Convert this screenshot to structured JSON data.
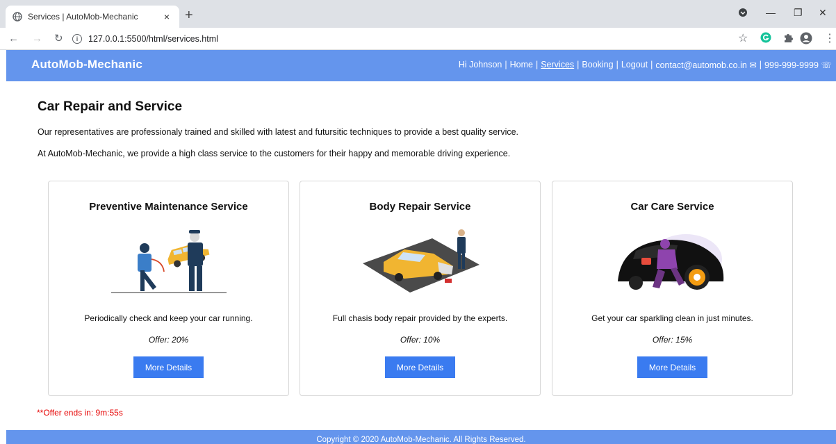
{
  "browser": {
    "tab_title": "Services | AutoMob-Mechanic",
    "tab_close": "×",
    "new_tab": "+",
    "url": "127.0.0.1:5500/html/services.html",
    "window_controls": [
      "—",
      "❐",
      "✕"
    ]
  },
  "header": {
    "brand": "AutoMob-Mechanic",
    "nav": {
      "greeting": "Hi Johnson",
      "home": "Home",
      "services": "Services",
      "booking": "Booking",
      "logout": "Logout",
      "email": "contact@automob.co.in ✉",
      "phone": "999-999-9999 ☏"
    }
  },
  "main": {
    "title": "Car Repair and Service",
    "intro_1": "Our representatives are professionaly trained and skilled with latest and futursitic techniques to provide a best quality service.",
    "intro_2": "At AutoMob-Mechanic, we provide a high class service to the customers for their happy and memorable driving experience.",
    "cards": [
      {
        "title": "Preventive Maintenance Service",
        "description": "Periodically check and keep your car running.",
        "offer": "Offer: 20%",
        "button": "More Details",
        "icon": "mechanics-lifting-car-illustration"
      },
      {
        "title": "Body Repair Service",
        "description": "Full chasis body repair provided by the experts.",
        "offer": "Offer: 10%",
        "button": "More Details",
        "icon": "damaged-car-repair-illustration"
      },
      {
        "title": "Car Care Service",
        "description": "Get your car sparkling clean in just minutes.",
        "offer": "Offer: 15%",
        "button": "More Details",
        "icon": "car-cleaning-illustration"
      }
    ],
    "timer": "**Offer ends in: 9m:55s"
  },
  "footer": {
    "text": "Copyright © 2020 AutoMob-Mechanic.  All Rights Reserved."
  },
  "colors": {
    "header_bg": "#6495ed",
    "button_bg": "#3a7bf0",
    "timer": "#e60000"
  }
}
